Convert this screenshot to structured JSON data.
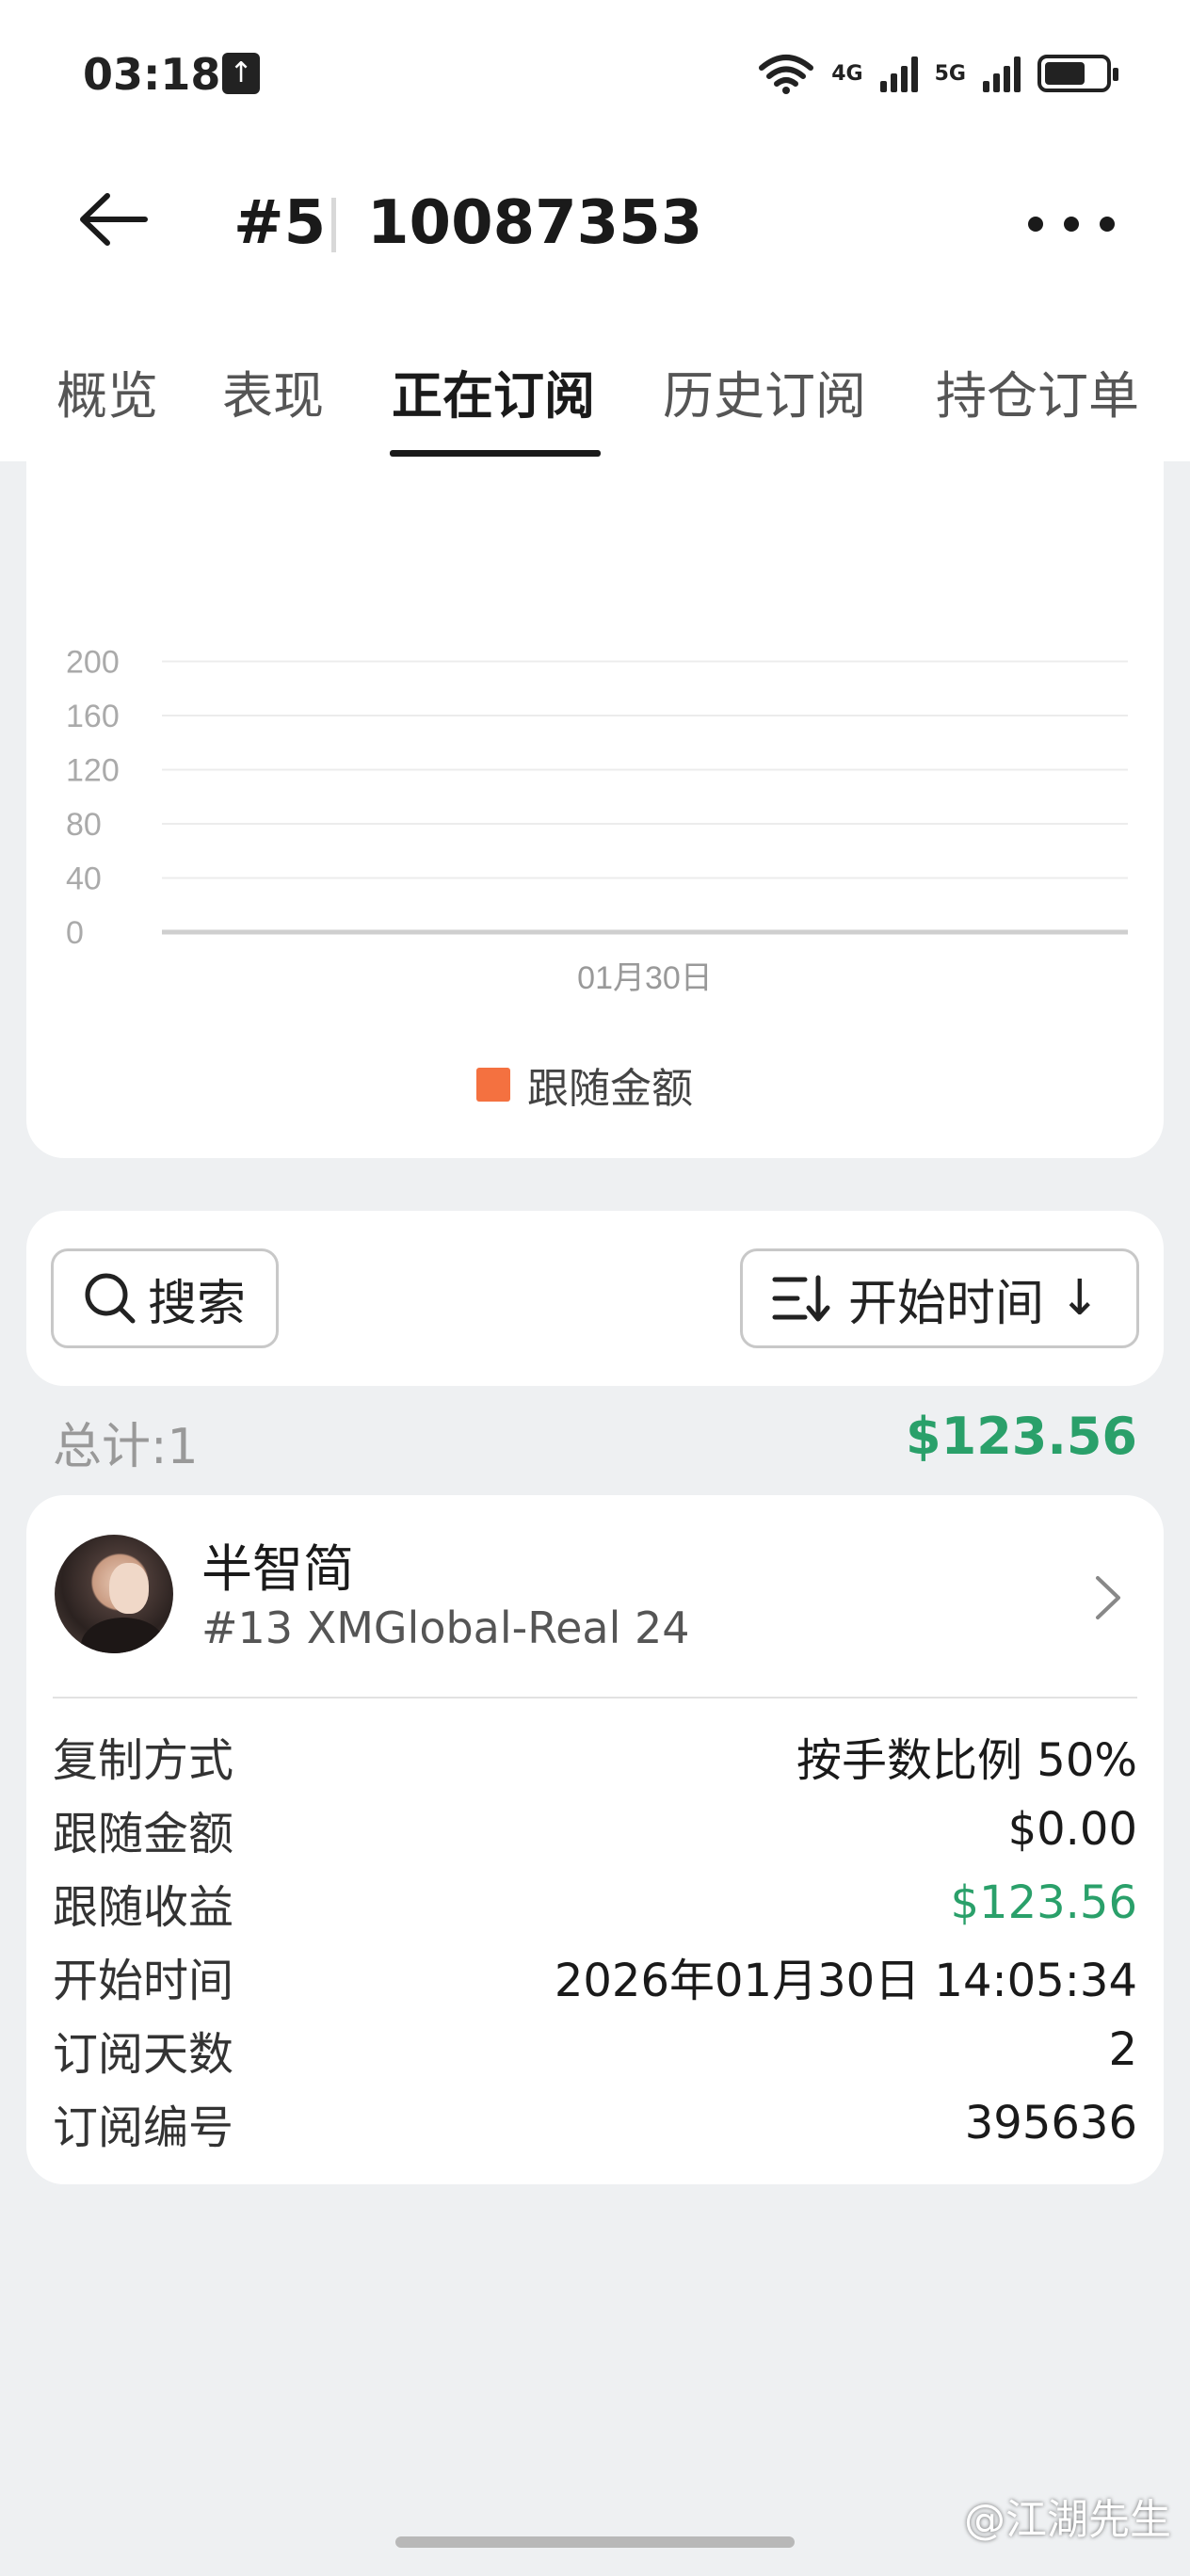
{
  "status_bar": {
    "time": "03:18",
    "net1": "4G",
    "net2": "5G",
    "battery_level": 0.68
  },
  "header": {
    "title_num": "#5",
    "title_id": "10087353"
  },
  "tabs": [
    {
      "label": "概览",
      "active": false
    },
    {
      "label": "表现",
      "active": false
    },
    {
      "label": "正在订阅",
      "active": true
    },
    {
      "label": "历史订阅",
      "active": false
    },
    {
      "label": "持仓订单",
      "active": false
    }
  ],
  "chart_data": {
    "type": "bar",
    "categories": [
      "01月30日"
    ],
    "series": [
      {
        "name": "跟随金额",
        "values": [
          0
        ]
      }
    ],
    "y_ticks": [
      0,
      40,
      80,
      120,
      160,
      200
    ],
    "ylim": [
      0,
      200
    ],
    "grid": true,
    "legend_position": "bottom",
    "color": "#f47140"
  },
  "toolbar": {
    "search_label": "搜索",
    "sort_label": "开始时间",
    "sort_direction_glyph": "↓"
  },
  "summary": {
    "total_label": "总计:1",
    "total_amount": "$123.56"
  },
  "subscription": {
    "name": "半智简",
    "server": "#13 XMGlobal-Real 24",
    "rows": [
      {
        "key": "复制方式",
        "value": "按手数比例 50%",
        "green": false
      },
      {
        "key": "跟随金额",
        "value": "$0.00",
        "green": false
      },
      {
        "key": "跟随收益",
        "value": "$123.56",
        "green": true
      },
      {
        "key": "开始时间",
        "value": "2026年01月30日 14:05:34",
        "green": false
      },
      {
        "key": "订阅天数",
        "value": "2",
        "green": false
      },
      {
        "key": "订阅编号",
        "value": "395636",
        "green": false
      }
    ]
  },
  "watermark": "@江湖先生",
  "colors": {
    "green": "#2aa06a",
    "accent_orange": "#f47140"
  }
}
